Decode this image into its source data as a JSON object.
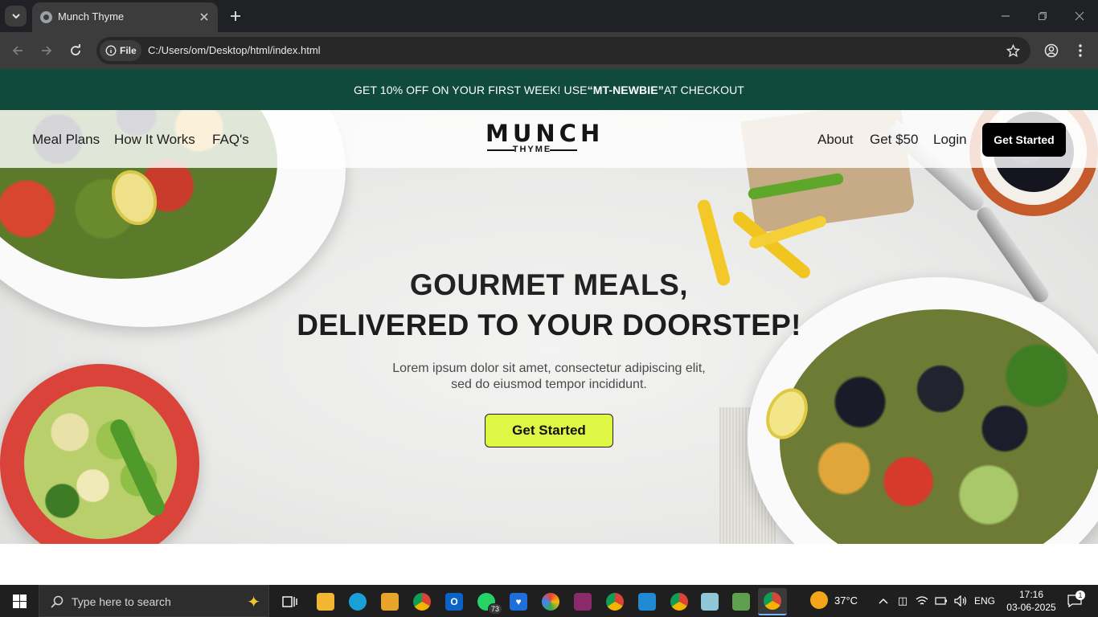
{
  "browser": {
    "tab_title": "Munch Thyme",
    "file_chip": "File",
    "url": "C:/Users/om/Desktop/html/index.html"
  },
  "promo": {
    "prefix": "GET 10% OFF ON YOUR FIRST WEEK! USE",
    "code": "“MT-NEWBIE”",
    "suffix": "AT CHECKOUT",
    "background": "#0f4a3c"
  },
  "nav": {
    "left_links": [
      "Meal Plans",
      "How It Works",
      "FAQ's"
    ],
    "logo_main": "MUNCH",
    "logo_sub": "THYME",
    "right_links": [
      "About",
      "Get $50",
      "Login"
    ],
    "cta": "Get Started"
  },
  "hero": {
    "line1": "GOURMET MEALS,",
    "line2": "DELIVERED TO YOUR DOORSTEP!",
    "description": "Lorem ipsum dolor sit amet, consectetur adipiscing elit, sed do eiusmod tempor incididunt.",
    "cta": "Get Started",
    "cta_color": "#ddf744"
  },
  "taskbar": {
    "search_placeholder": "Type here to search",
    "whatsapp_badge": "73",
    "weather": "37°C",
    "language": "ENG",
    "time": "17:16",
    "date": "03-06-2025",
    "notification_count": "1"
  }
}
